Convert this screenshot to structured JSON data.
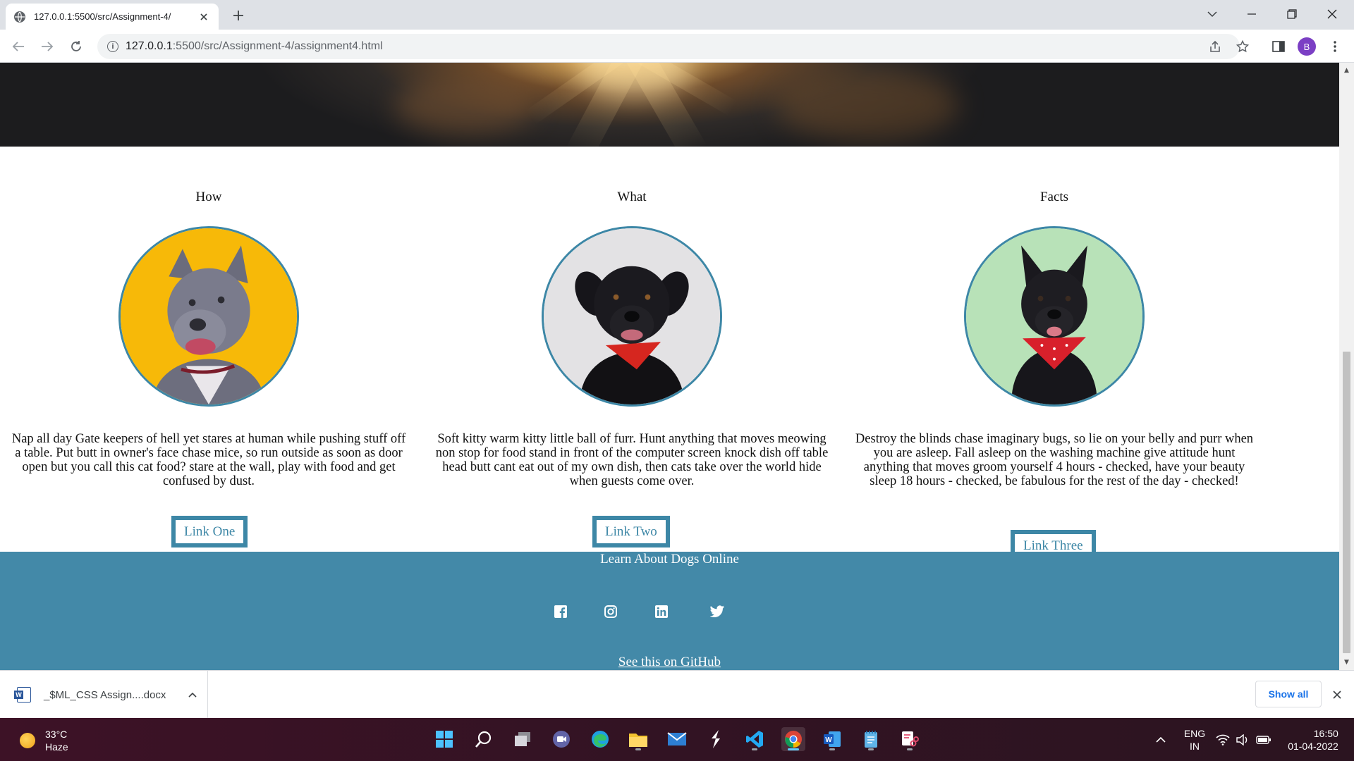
{
  "browser": {
    "tab_title": "127.0.0.1:5500/src/Assignment-4/",
    "url_host": "127.0.0.1",
    "url_rest": ":5500/src/Assignment-4/assignment4.html",
    "profile_initial": "B"
  },
  "page": {
    "columns": [
      {
        "heading": "How",
        "image": "grey-pitbull-on-yellow",
        "text": "Nap all day Gate keepers of hell yet stares at human while pushing stuff off a table. Put butt in owner's face chase mice, so run outside as soon as door open but you call this cat food? stare at the wall, play with food and get confused by dust.",
        "link": "Link One"
      },
      {
        "heading": "What",
        "image": "black-dog-red-bandana-on-grey",
        "text": "Soft kitty warm kitty little ball of furr. Hunt anything that moves meowing non stop for food stand in front of the computer screen knock dish off table head butt cant eat out of my own dish, then cats take over the world hide when guests come over.",
        "link": "Link Two"
      },
      {
        "heading": "Facts",
        "image": "black-dog-polka-bandana-on-green",
        "text": "Destroy the blinds chase imaginary bugs, so lie on your belly and purr when you are asleep. Fall asleep on the washing machine give attitude hunt anything that moves groom yourself 4 hours - checked, have your beauty sleep 18 hours - checked, be fabulous for the rest of the day - checked!",
        "link": "Link Three"
      }
    ],
    "footer": {
      "title": "Learn About Dogs Online",
      "social_icons": [
        "facebook-icon",
        "instagram-icon",
        "linkedin-icon",
        "twitter-icon"
      ],
      "github_link": "See this on GitHub"
    }
  },
  "downloads": {
    "file_name": "_$ML_CSS Assign....docx",
    "show_all": "Show all"
  },
  "taskbar": {
    "temperature": "33°C",
    "weather": "Haze",
    "language": "ENG",
    "region": "IN",
    "time": "16:50",
    "date": "01-04-2022"
  },
  "colors": {
    "accent": "#4389a8",
    "tab_bar": "#dee1e6"
  }
}
